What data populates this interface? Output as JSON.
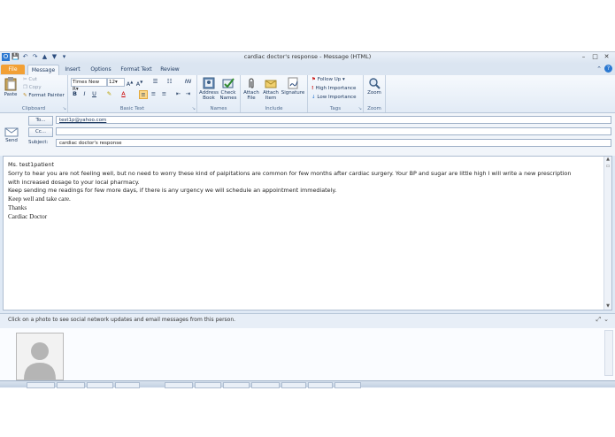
{
  "window": {
    "title": "cardiac doctor's response - Message (HTML)",
    "accent_color": "#2b5797"
  },
  "qat": {
    "save": "💾",
    "undo": "↶",
    "redo": "↷",
    "up": "▲",
    "down": "▼",
    "customize": "▾"
  },
  "tabs": [
    {
      "label": "File"
    },
    {
      "label": "Message"
    },
    {
      "label": "Insert"
    },
    {
      "label": "Options"
    },
    {
      "label": "Format Text"
    },
    {
      "label": "Review"
    }
  ],
  "ribbon": {
    "clipboard": {
      "label": "Clipboard",
      "paste": "Paste",
      "cut": "Cut",
      "copy": "Copy",
      "format_painter": "Format Painter"
    },
    "basic_text": {
      "label": "Basic Text",
      "font": "Times New R",
      "size": "12",
      "bold": "B",
      "italic": "I",
      "underline": "U"
    },
    "names": {
      "label": "Names",
      "address_book": [
        "Address",
        "Book"
      ],
      "check_names": [
        "Check",
        "Names"
      ]
    },
    "include": {
      "label": "Include",
      "attach_file": [
        "Attach",
        "File"
      ],
      "attach_item": [
        "Attach",
        "Item"
      ],
      "signature": "Signature"
    },
    "tags": {
      "label": "Tags",
      "follow_up": "Follow Up",
      "high_importance": "High Importance",
      "low_importance": "Low Importance"
    },
    "zoom": {
      "label": "Zoom",
      "zoom": "Zoom"
    }
  },
  "headers": {
    "send": "Send",
    "to_button": "To...",
    "to_value": "test1p@yahoo.com",
    "cc_button": "Cc...",
    "cc_value": "",
    "subject_label": "Subject:",
    "subject_value": "cardiac doctor's response"
  },
  "body": {
    "greeting": "Ms. test1patient",
    "line1": "Sorry to hear you are not feeling well, but no need to worry these kind of palpitations are common for few months after cardiac surgery. Your BP and sugar are little high I will write a new prescription",
    "line2": "with increased dosage to your local pharmacy.",
    "line3": "Keep sending me readings for few more days, if there is any urgency we will schedule an appointment immediately.",
    "line4": "Keep well and take care.",
    "line5": "Thanks",
    "line6": "Cardiac Doctor"
  },
  "people_pane": {
    "message": "Click on a photo to see social network updates and email messages from this person."
  }
}
